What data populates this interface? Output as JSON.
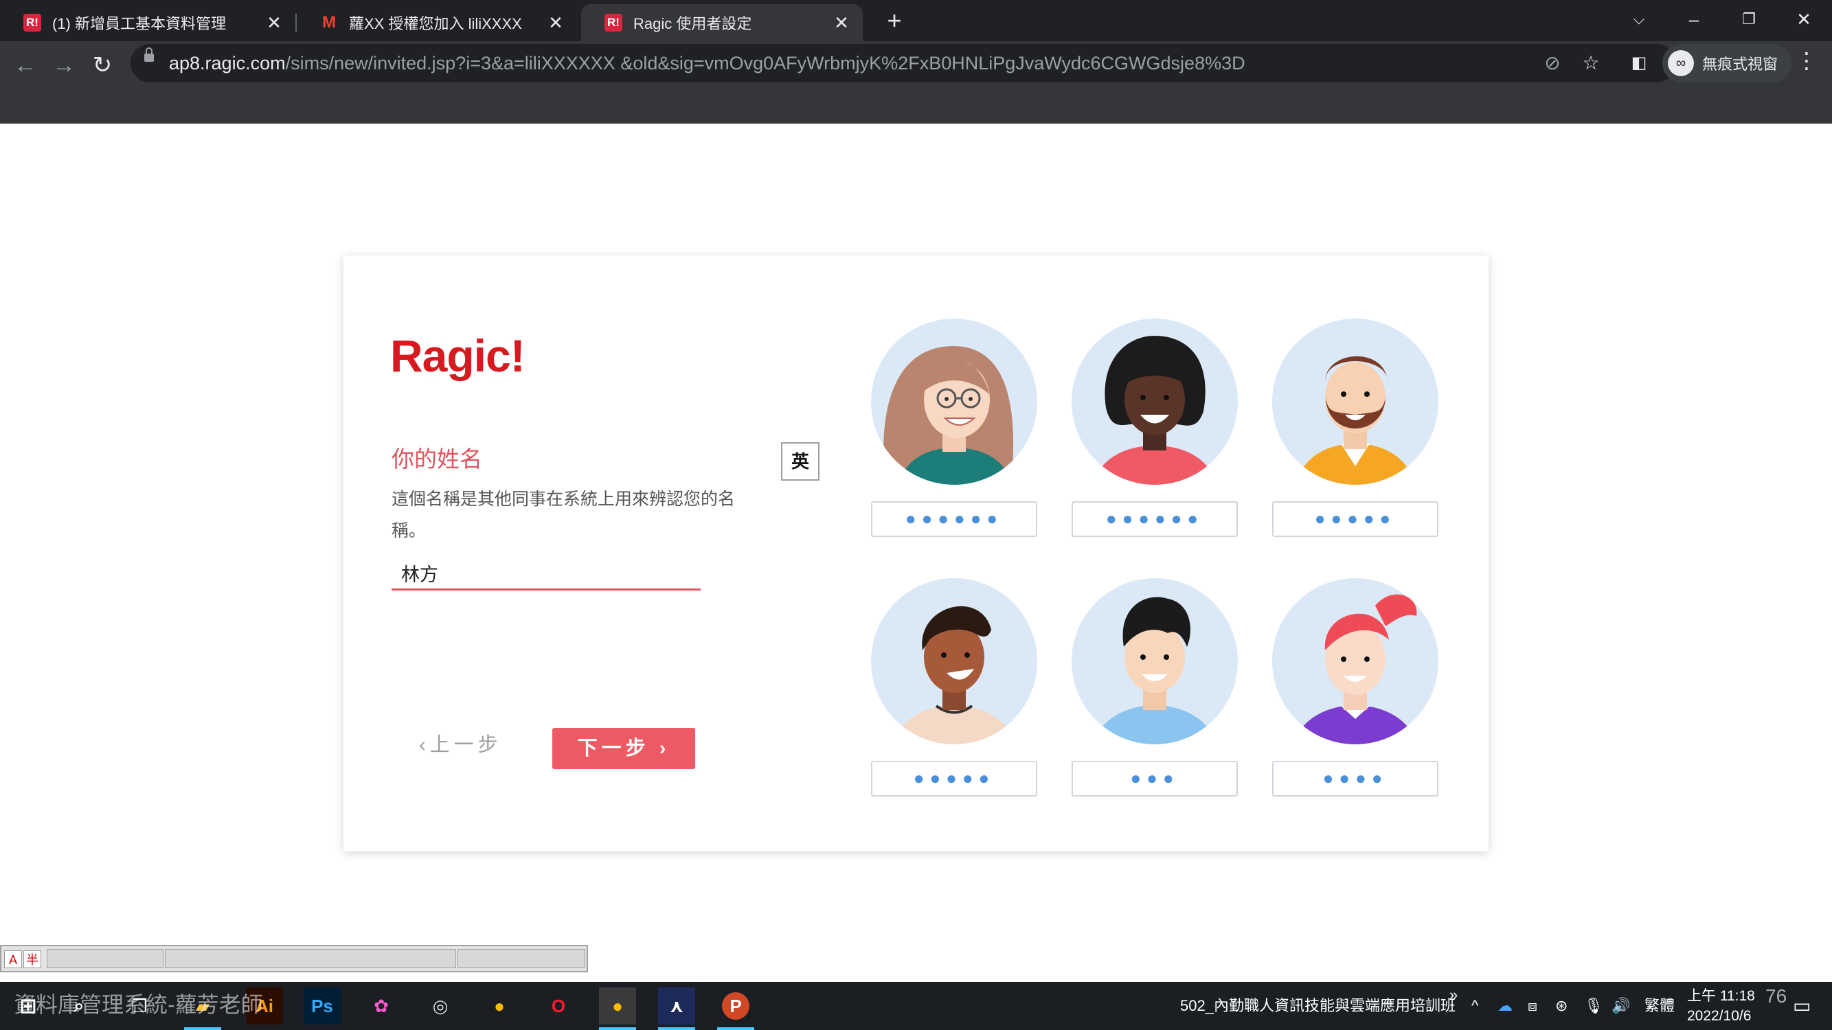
{
  "browser": {
    "tabs": [
      {
        "favicon": "R!",
        "title": "(1) 新增員工基本資料管理",
        "close": "✕"
      },
      {
        "favicon": "M",
        "title": "蘿XX  授權您加入 liliXXXX",
        "close": "✕"
      },
      {
        "favicon": "R!",
        "title": "Ragic 使用者設定",
        "close": "✕"
      }
    ],
    "new_tab": "+",
    "url_host": "ap8.ragic.com",
    "url_path": "/sims/new/invited.jsp?i=3&a=liliXXXXXX &old&sig=vmOvg0AFyWrbmjyK%2FxB0HNLiPgJvaWydc6CGWGdsje8%3D",
    "incognito_label": "無痕式視窗"
  },
  "page": {
    "logo": "Ragic!",
    "question_title": "你的姓名",
    "question_desc": "這個名稱是其他同事在系統上用來辨認您的名稱。",
    "name_value": "林方",
    "ime_mode": "英",
    "prev_label": "上一步",
    "next_label": "下一步",
    "avatars": [
      {
        "name": "woman-glasses",
        "masked": "●●●●●●"
      },
      {
        "name": "woman-curly",
        "masked": "●●●●●●"
      },
      {
        "name": "man-beard",
        "masked": "●●●●●"
      },
      {
        "name": "man-smile",
        "masked": "●●●●●"
      },
      {
        "name": "man-young",
        "masked": "●●●"
      },
      {
        "name": "woman-ponytail",
        "masked": "●●●●"
      }
    ],
    "colors": {
      "accent": "#ee5a64",
      "brand": "#d71920",
      "avatar_bg": "#dbe9f7",
      "dots": "#4a90d9"
    }
  },
  "imebar": {
    "mode_a": "A",
    "mode_b": "半"
  },
  "taskbar": {
    "watermark": "資料庫管理系統-蘿芳老師",
    "tray_label": "502_內勤職人資訊技能與雲端應用培訓班",
    "lang": "繁體",
    "time": "上午 11:18",
    "date": "2022/10/6",
    "badge": "76",
    "apps": [
      "Ps",
      "Ai",
      "chrome",
      "opera",
      "acrobat",
      "powerpoint"
    ]
  }
}
